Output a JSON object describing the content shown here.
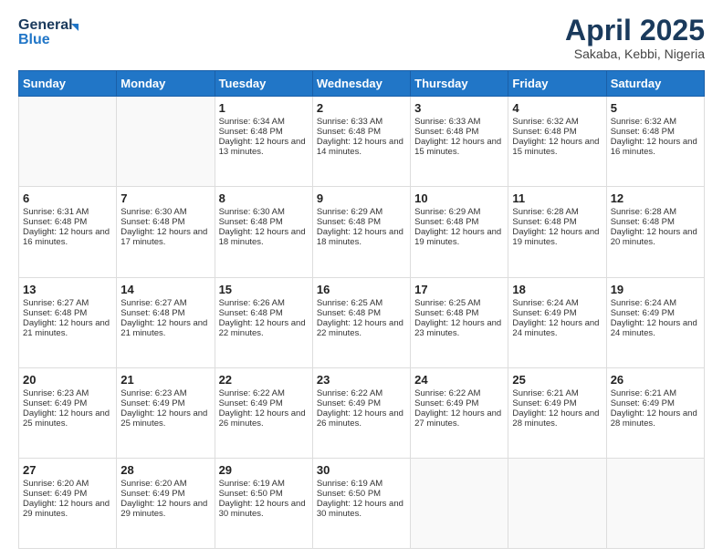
{
  "header": {
    "logo_line1": "General",
    "logo_line2": "Blue",
    "month_title": "April 2025",
    "subtitle": "Sakaba, Kebbi, Nigeria"
  },
  "days_of_week": [
    "Sunday",
    "Monday",
    "Tuesday",
    "Wednesday",
    "Thursday",
    "Friday",
    "Saturday"
  ],
  "weeks": [
    [
      {
        "day": "",
        "sunrise": "",
        "sunset": "",
        "daylight": ""
      },
      {
        "day": "",
        "sunrise": "",
        "sunset": "",
        "daylight": ""
      },
      {
        "day": "1",
        "sunrise": "Sunrise: 6:34 AM",
        "sunset": "Sunset: 6:48 PM",
        "daylight": "Daylight: 12 hours and 13 minutes."
      },
      {
        "day": "2",
        "sunrise": "Sunrise: 6:33 AM",
        "sunset": "Sunset: 6:48 PM",
        "daylight": "Daylight: 12 hours and 14 minutes."
      },
      {
        "day": "3",
        "sunrise": "Sunrise: 6:33 AM",
        "sunset": "Sunset: 6:48 PM",
        "daylight": "Daylight: 12 hours and 15 minutes."
      },
      {
        "day": "4",
        "sunrise": "Sunrise: 6:32 AM",
        "sunset": "Sunset: 6:48 PM",
        "daylight": "Daylight: 12 hours and 15 minutes."
      },
      {
        "day": "5",
        "sunrise": "Sunrise: 6:32 AM",
        "sunset": "Sunset: 6:48 PM",
        "daylight": "Daylight: 12 hours and 16 minutes."
      }
    ],
    [
      {
        "day": "6",
        "sunrise": "Sunrise: 6:31 AM",
        "sunset": "Sunset: 6:48 PM",
        "daylight": "Daylight: 12 hours and 16 minutes."
      },
      {
        "day": "7",
        "sunrise": "Sunrise: 6:30 AM",
        "sunset": "Sunset: 6:48 PM",
        "daylight": "Daylight: 12 hours and 17 minutes."
      },
      {
        "day": "8",
        "sunrise": "Sunrise: 6:30 AM",
        "sunset": "Sunset: 6:48 PM",
        "daylight": "Daylight: 12 hours and 18 minutes."
      },
      {
        "day": "9",
        "sunrise": "Sunrise: 6:29 AM",
        "sunset": "Sunset: 6:48 PM",
        "daylight": "Daylight: 12 hours and 18 minutes."
      },
      {
        "day": "10",
        "sunrise": "Sunrise: 6:29 AM",
        "sunset": "Sunset: 6:48 PM",
        "daylight": "Daylight: 12 hours and 19 minutes."
      },
      {
        "day": "11",
        "sunrise": "Sunrise: 6:28 AM",
        "sunset": "Sunset: 6:48 PM",
        "daylight": "Daylight: 12 hours and 19 minutes."
      },
      {
        "day": "12",
        "sunrise": "Sunrise: 6:28 AM",
        "sunset": "Sunset: 6:48 PM",
        "daylight": "Daylight: 12 hours and 20 minutes."
      }
    ],
    [
      {
        "day": "13",
        "sunrise": "Sunrise: 6:27 AM",
        "sunset": "Sunset: 6:48 PM",
        "daylight": "Daylight: 12 hours and 21 minutes."
      },
      {
        "day": "14",
        "sunrise": "Sunrise: 6:27 AM",
        "sunset": "Sunset: 6:48 PM",
        "daylight": "Daylight: 12 hours and 21 minutes."
      },
      {
        "day": "15",
        "sunrise": "Sunrise: 6:26 AM",
        "sunset": "Sunset: 6:48 PM",
        "daylight": "Daylight: 12 hours and 22 minutes."
      },
      {
        "day": "16",
        "sunrise": "Sunrise: 6:25 AM",
        "sunset": "Sunset: 6:48 PM",
        "daylight": "Daylight: 12 hours and 22 minutes."
      },
      {
        "day": "17",
        "sunrise": "Sunrise: 6:25 AM",
        "sunset": "Sunset: 6:48 PM",
        "daylight": "Daylight: 12 hours and 23 minutes."
      },
      {
        "day": "18",
        "sunrise": "Sunrise: 6:24 AM",
        "sunset": "Sunset: 6:49 PM",
        "daylight": "Daylight: 12 hours and 24 minutes."
      },
      {
        "day": "19",
        "sunrise": "Sunrise: 6:24 AM",
        "sunset": "Sunset: 6:49 PM",
        "daylight": "Daylight: 12 hours and 24 minutes."
      }
    ],
    [
      {
        "day": "20",
        "sunrise": "Sunrise: 6:23 AM",
        "sunset": "Sunset: 6:49 PM",
        "daylight": "Daylight: 12 hours and 25 minutes."
      },
      {
        "day": "21",
        "sunrise": "Sunrise: 6:23 AM",
        "sunset": "Sunset: 6:49 PM",
        "daylight": "Daylight: 12 hours and 25 minutes."
      },
      {
        "day": "22",
        "sunrise": "Sunrise: 6:22 AM",
        "sunset": "Sunset: 6:49 PM",
        "daylight": "Daylight: 12 hours and 26 minutes."
      },
      {
        "day": "23",
        "sunrise": "Sunrise: 6:22 AM",
        "sunset": "Sunset: 6:49 PM",
        "daylight": "Daylight: 12 hours and 26 minutes."
      },
      {
        "day": "24",
        "sunrise": "Sunrise: 6:22 AM",
        "sunset": "Sunset: 6:49 PM",
        "daylight": "Daylight: 12 hours and 27 minutes."
      },
      {
        "day": "25",
        "sunrise": "Sunrise: 6:21 AM",
        "sunset": "Sunset: 6:49 PM",
        "daylight": "Daylight: 12 hours and 28 minutes."
      },
      {
        "day": "26",
        "sunrise": "Sunrise: 6:21 AM",
        "sunset": "Sunset: 6:49 PM",
        "daylight": "Daylight: 12 hours and 28 minutes."
      }
    ],
    [
      {
        "day": "27",
        "sunrise": "Sunrise: 6:20 AM",
        "sunset": "Sunset: 6:49 PM",
        "daylight": "Daylight: 12 hours and 29 minutes."
      },
      {
        "day": "28",
        "sunrise": "Sunrise: 6:20 AM",
        "sunset": "Sunset: 6:49 PM",
        "daylight": "Daylight: 12 hours and 29 minutes."
      },
      {
        "day": "29",
        "sunrise": "Sunrise: 6:19 AM",
        "sunset": "Sunset: 6:50 PM",
        "daylight": "Daylight: 12 hours and 30 minutes."
      },
      {
        "day": "30",
        "sunrise": "Sunrise: 6:19 AM",
        "sunset": "Sunset: 6:50 PM",
        "daylight": "Daylight: 12 hours and 30 minutes."
      },
      {
        "day": "",
        "sunrise": "",
        "sunset": "",
        "daylight": ""
      },
      {
        "day": "",
        "sunrise": "",
        "sunset": "",
        "daylight": ""
      },
      {
        "day": "",
        "sunrise": "",
        "sunset": "",
        "daylight": ""
      }
    ]
  ]
}
